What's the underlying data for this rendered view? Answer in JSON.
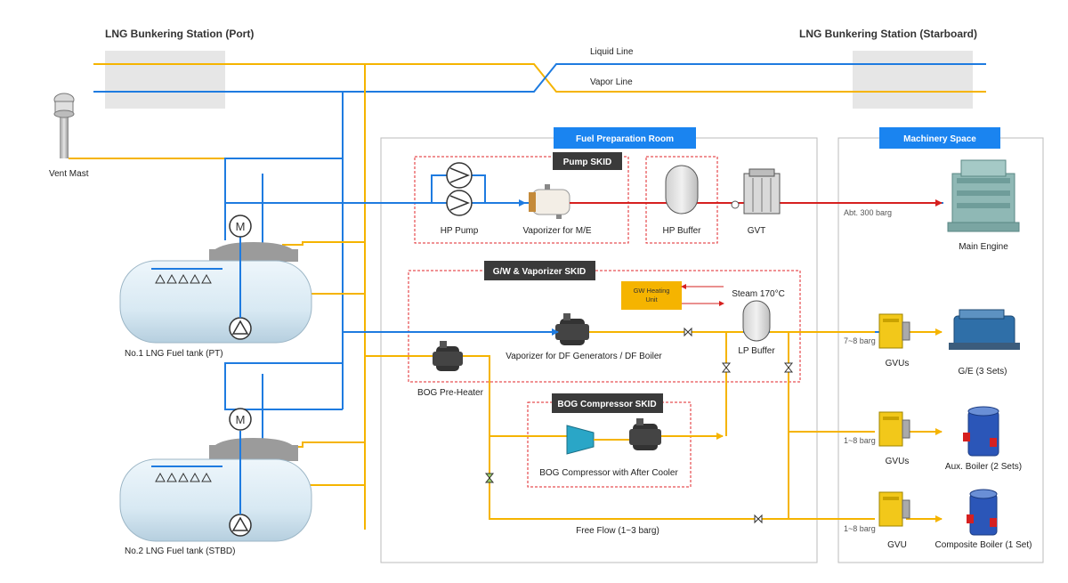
{
  "stations": {
    "port": "LNG Bunkering Station (Port)",
    "starboard": "LNG Bunkering Station (Starboard)"
  },
  "lines": {
    "liquid": "Liquid Line",
    "vapor": "Vapor Line"
  },
  "vent_mast": "Vent Mast",
  "tanks": {
    "tank1": "No.1 LNG Fuel tank (PT)",
    "tank2": "No.2 LNG Fuel tank (STBD)"
  },
  "rooms": {
    "fuel_prep": "Fuel Preparation Room",
    "machinery": "Machinery Space"
  },
  "skids": {
    "pump": "Pump SKID",
    "gw_vaporizer": "G/W & Vaporizer SKID",
    "bog_compressor": "BOG Compressor SKID"
  },
  "components": {
    "hp_pump": "HP Pump",
    "vaporizer_me": "Vaporizer for M/E",
    "hp_buffer": "HP Buffer",
    "gvt": "GVT",
    "gw_heating_unit": "GW Heating Unit",
    "steam": "Steam 170°C",
    "vaporizer_df": "Vaporizer for DF Generators / DF Boiler",
    "lp_buffer": "LP Buffer",
    "bog_preheater": "BOG  Pre-Heater",
    "bog_compressor": "BOG Compressor with After Cooler",
    "free_flow": "Free Flow (1~3 barg)"
  },
  "consumers": {
    "main_engine": "Main Engine",
    "ge": "G/E (3 Sets)",
    "aux_boiler": "Aux. Boiler (2 Sets)",
    "composite_boiler": "Composite Boiler (1 Set)",
    "gvus1": "GVUs",
    "gvus2": "GVUs",
    "gvu": "GVU"
  },
  "pressures": {
    "me": "Abt. 300 barg",
    "ge": "7~8 barg",
    "aux": "1~8 barg",
    "comp": "1~8 barg"
  },
  "colors": {
    "liquid": "#f5b400",
    "vapor": "#1e7be0",
    "hp_gas": "#d6201f",
    "skid_border": "#e0242a",
    "room_header": "#1a84f0",
    "skid_header": "#3a3a3a",
    "gw_unit": "#f5b400",
    "station_box": "#e6e6e6"
  }
}
